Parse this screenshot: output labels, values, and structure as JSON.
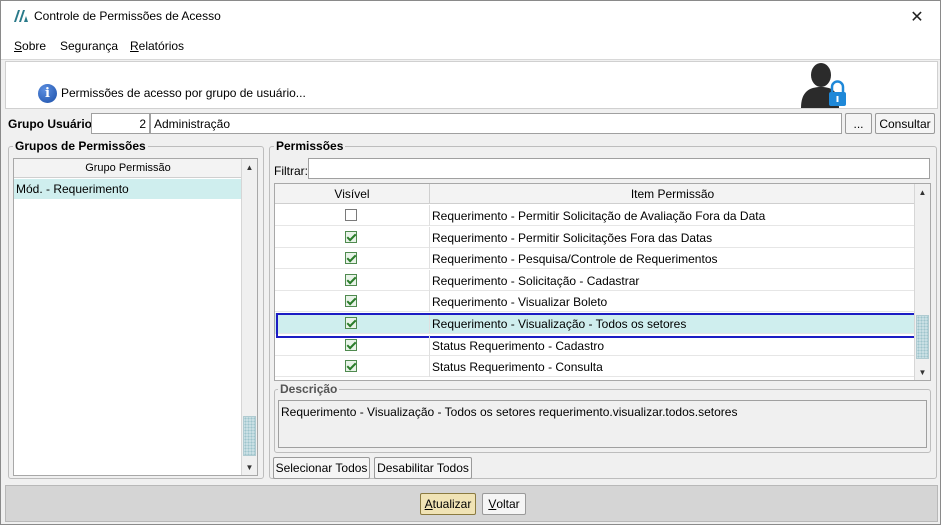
{
  "window": {
    "title": "Controle de Permissões de Acesso"
  },
  "menu": [
    {
      "key": "S",
      "rest": "obre"
    },
    {
      "key": "S",
      "rest": "egurança",
      "plain": "Segurança"
    },
    {
      "key": "R",
      "rest": "elatórios"
    }
  ],
  "menu_labels": {
    "sobre_key": "S",
    "sobre_rest": "obre",
    "seguranca": "Segurança",
    "relatorios_key": "R",
    "relatorios_rest": "elatórios"
  },
  "header": {
    "text": "Permissões de acesso por grupo de usuário..."
  },
  "group": {
    "label": "Grupo Usuário:",
    "code": "2",
    "name": "Administração",
    "lookup_button": "...",
    "consult_button": "Consultar"
  },
  "left_panel": {
    "legend": "Grupos de Permissões",
    "column": "Grupo Permissão",
    "rows": [
      "Mód. - Requerimento"
    ]
  },
  "right_panel": {
    "legend": "Permissões",
    "filter_label": "Filtrar:",
    "filter_value": "",
    "columns": {
      "visible": "Visível",
      "item": "Item Permissão"
    },
    "rows": [
      {
        "checked": false,
        "item": "Requerimento - Permitir Solicitação de Avaliação Fora da Data"
      },
      {
        "checked": true,
        "item": "Requerimento - Permitir Solicitações Fora das Datas"
      },
      {
        "checked": true,
        "item": "Requerimento - Pesquisa/Controle de Requerimentos"
      },
      {
        "checked": true,
        "item": "Requerimento - Solicitação - Cadastrar"
      },
      {
        "checked": true,
        "item": "Requerimento - Visualizar Boleto"
      },
      {
        "checked": true,
        "item": "Requerimento - Visualização - Todos os setores",
        "selected": true
      },
      {
        "checked": true,
        "item": "Status Requerimento - Cadastro"
      },
      {
        "checked": true,
        "item": "Status Requerimento - Consulta"
      }
    ],
    "description_legend": "Descrição",
    "description": "Requerimento - Visualização - Todos os setores requerimento.visualizar.todos.setores",
    "select_all": "Selecionar Todos",
    "disable_all": "Desabilitar Todos"
  },
  "footer": {
    "update_key": "A",
    "update_rest": "tualizar",
    "back_key": "V",
    "back_rest": "oltar"
  },
  "colors": {
    "selection": "#cfeeee",
    "focus_border": "#1c1cc4",
    "update_button": "#f0e3b5"
  },
  "icons": [
    "app-logo-icon",
    "close-icon",
    "info-icon",
    "user-lock-icon",
    "scroll-up-icon",
    "scroll-down-icon"
  ]
}
